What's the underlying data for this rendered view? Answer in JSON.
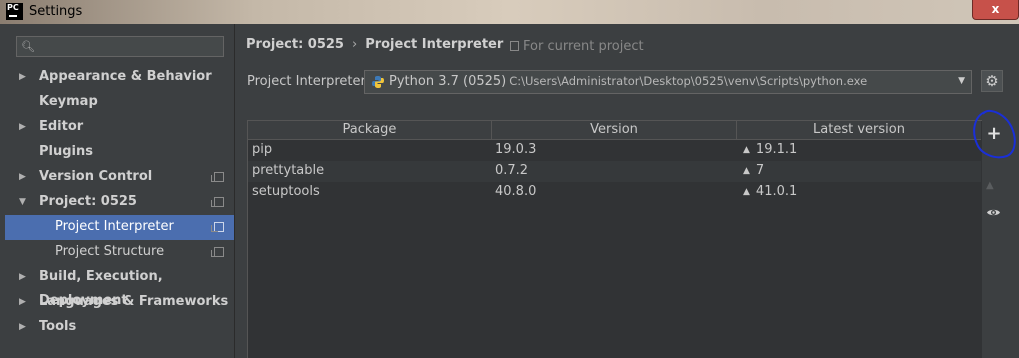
{
  "window": {
    "title": "Settings",
    "app_icon_text": "PC",
    "close_label": "x"
  },
  "search": {
    "placeholder": "",
    "value": ""
  },
  "sidebar": {
    "items": [
      {
        "label": "Appearance & Behavior",
        "expandable": true
      },
      {
        "label": "Keymap",
        "expandable": false
      },
      {
        "label": "Editor",
        "expandable": true
      },
      {
        "label": "Plugins",
        "expandable": false
      },
      {
        "label": "Version Control",
        "expandable": true
      },
      {
        "label": "Project: 0525",
        "expandable": true
      },
      {
        "label": "Project Interpreter",
        "selected": true
      },
      {
        "label": "Project Structure"
      },
      {
        "label": "Build, Execution, Deployment",
        "expandable": true
      },
      {
        "label": "Languages & Frameworks",
        "expandable": true
      },
      {
        "label": "Tools",
        "expandable": true
      }
    ]
  },
  "breadcrumb": {
    "project": "Project: 0525",
    "separator": "›",
    "page": "Project Interpreter"
  },
  "scope": {
    "label": "For current project"
  },
  "interpreter": {
    "label": "Project Interpreter:",
    "name": "Python 3.7 (0525)",
    "path": "C:\\Users\\Administrator\\Desktop\\0525\\venv\\Scripts\\python.exe"
  },
  "table": {
    "headers": [
      "Package",
      "Version",
      "Latest version"
    ],
    "rows": [
      {
        "package": "pip",
        "version": "19.0.3",
        "latest": "19.1.1"
      },
      {
        "package": "prettytable",
        "version": "0.7.2",
        "latest": "7"
      },
      {
        "package": "setuptools",
        "version": "40.8.0",
        "latest": "41.0.1"
      }
    ]
  },
  "toolbar": {
    "add_label": "+"
  },
  "colors": {
    "selection": "#4b6eaf",
    "background": "#3c3f41",
    "annotation": "#1a2fd8"
  }
}
